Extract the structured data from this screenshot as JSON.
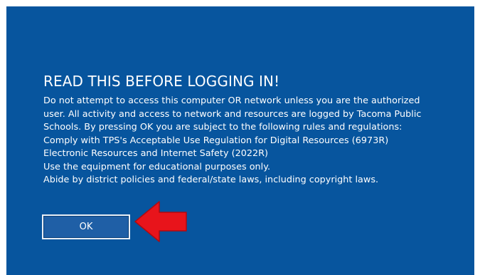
{
  "dialog": {
    "title": "READ THIS BEFORE LOGGING IN!",
    "lines": [
      "Do not attempt to access this computer OR network unless you are the authorized",
      "user. All activity and access to network and resources are logged by Tacoma Public",
      "Schools. By pressing OK you are subject to the following rules and regulations:",
      "Comply with TPS's Acceptable Use Regulation for Digital Resources (6973R)",
      "Electronic Resources and Internet Safety (2022R)",
      "Use the equipment for educational purposes only.",
      "Abide by district policies and federal/state laws, including copyright laws."
    ],
    "ok_label": "OK"
  },
  "annotation": {
    "icon": "red-arrow-pointing-left",
    "color": "#e8141b"
  },
  "colors": {
    "background": "#07559e",
    "text": "#ffffff"
  }
}
